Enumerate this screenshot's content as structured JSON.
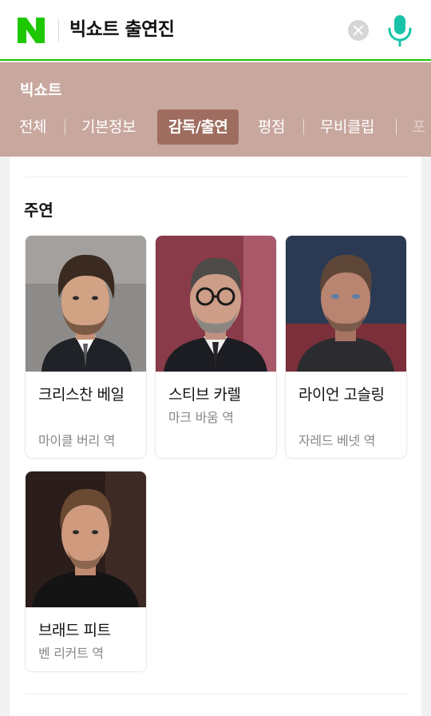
{
  "search": {
    "query": "빅쇼트 출연진",
    "logo_letter": "N"
  },
  "section": {
    "title": "빅쇼트",
    "tabs": [
      {
        "label": "전체",
        "active": false
      },
      {
        "label": "기본정보",
        "active": false
      },
      {
        "label": "감독/출연",
        "active": true
      },
      {
        "label": "평점",
        "active": false
      },
      {
        "label": "무비클립",
        "active": false
      },
      {
        "label": "포",
        "active": false
      }
    ]
  },
  "cast": {
    "heading": "주연",
    "actors": [
      {
        "name": "크리스찬 베일",
        "role": "마이클 버리 역"
      },
      {
        "name": "스티브 카렐",
        "role": "마크 바움 역"
      },
      {
        "name": "라이언 고슬링",
        "role": "자레드 베넷 역"
      },
      {
        "name": "브래드 피트",
        "role": "벤 리커트 역"
      }
    ]
  },
  "colors": {
    "brand_green": "#1ec800",
    "mic_teal": "#19c3a8",
    "section_bg": "#c8a79e",
    "active_tab": "#9e6d5f"
  },
  "icons": {
    "logo": "naver-n-logo",
    "clear": "close-icon",
    "mic": "microphone-icon"
  }
}
